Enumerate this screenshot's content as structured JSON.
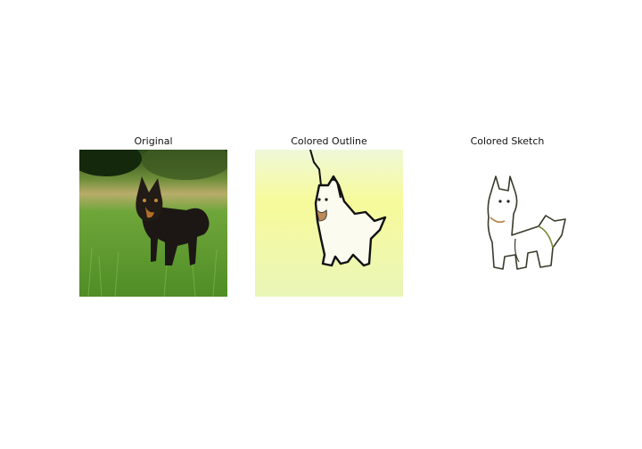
{
  "panels": [
    {
      "title": "Original",
      "image": "dog-photo"
    },
    {
      "title": "Colored Outline",
      "image": "dog-colored-outline"
    },
    {
      "title": "Colored Sketch",
      "image": "dog-colored-sketch"
    }
  ],
  "colors": {
    "grass": "#5a9a2a",
    "dark_tree": "#1e3c12",
    "dog_fur": "#1c1714",
    "tan": "#b0702a",
    "outline_bg": "#f5fbb0",
    "sketch_line": "#3a3a2a"
  }
}
